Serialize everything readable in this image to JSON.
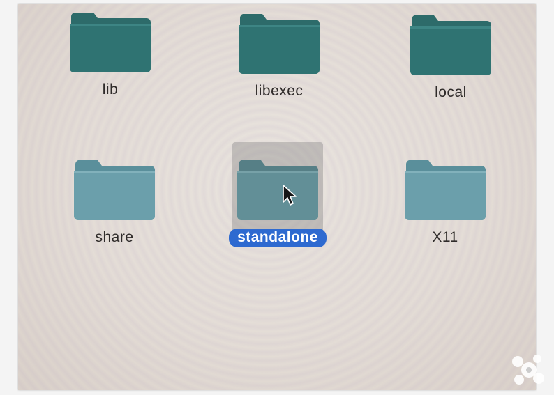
{
  "folders": {
    "row1": [
      {
        "label": "lib"
      },
      {
        "label": "libexec"
      },
      {
        "label": "local"
      }
    ],
    "row2": [
      {
        "label": "share"
      },
      {
        "label": "standalone",
        "selected": true
      },
      {
        "label": "X11"
      }
    ]
  },
  "colors": {
    "folder_dark": "#2f6f6e",
    "folder_light": "#5f93a0",
    "selection_label": "#2e6ad0"
  },
  "icons": {
    "folder": "folder-icon",
    "cursor": "mouse-pointer-icon",
    "watermark": "watermark-logo-icon"
  }
}
